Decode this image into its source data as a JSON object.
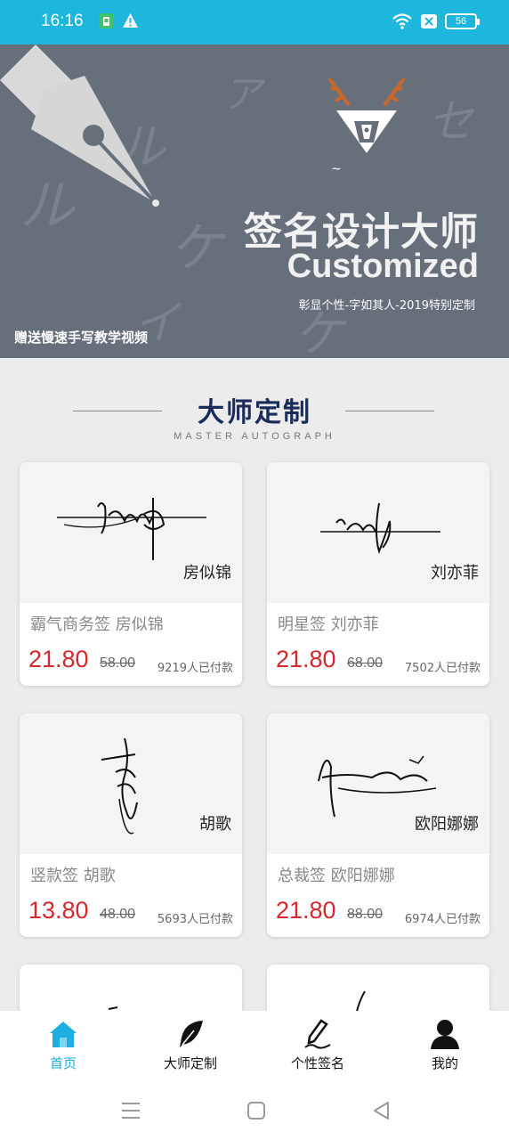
{
  "status_bar": {
    "time": "16:16",
    "battery": "56",
    "icons": [
      "app-notification-icon",
      "warning-icon",
      "wifi-icon",
      "sim-x-icon",
      "battery-icon"
    ]
  },
  "banner": {
    "title": "签名设计大师",
    "title_en": "Customized",
    "slogan": "彰显个性-字如其人-2019特别定制",
    "gift": "赠送慢速手写教学视频"
  },
  "section": {
    "title": "大师定制",
    "subtitle": "MASTER AUTOGRAPH"
  },
  "cards": [
    {
      "image_name": "房似锦",
      "name": "霸气商务签   房似锦",
      "price": "21.80",
      "original_price": "58.00",
      "paid": "9219人已付款"
    },
    {
      "image_name": "刘亦菲",
      "name": "明星签   刘亦菲",
      "price": "21.80",
      "original_price": "68.00",
      "paid": "7502人已付款"
    },
    {
      "image_name": "胡歌",
      "name": "竖款签   胡歌",
      "price": "13.80",
      "original_price": "48.00",
      "paid": "5693人已付款"
    },
    {
      "image_name": "欧阳娜娜",
      "name": "总裁签   欧阳娜娜",
      "price": "21.80",
      "original_price": "88.00",
      "paid": "6974人已付款"
    }
  ],
  "bottom_nav": {
    "items": [
      {
        "label": "首页",
        "icon": "home-icon",
        "active": true
      },
      {
        "label": "大师定制",
        "icon": "feather-icon",
        "active": false
      },
      {
        "label": "个性签名",
        "icon": "pen-icon",
        "active": false
      },
      {
        "label": "我的",
        "icon": "user-icon",
        "active": false
      }
    ]
  },
  "colors": {
    "status_bar": "#1eb6dc",
    "banner_bg": "#676f7b",
    "price": "#d4282d",
    "nav_active": "#1eaee0",
    "section_title": "#1b2b5a"
  }
}
